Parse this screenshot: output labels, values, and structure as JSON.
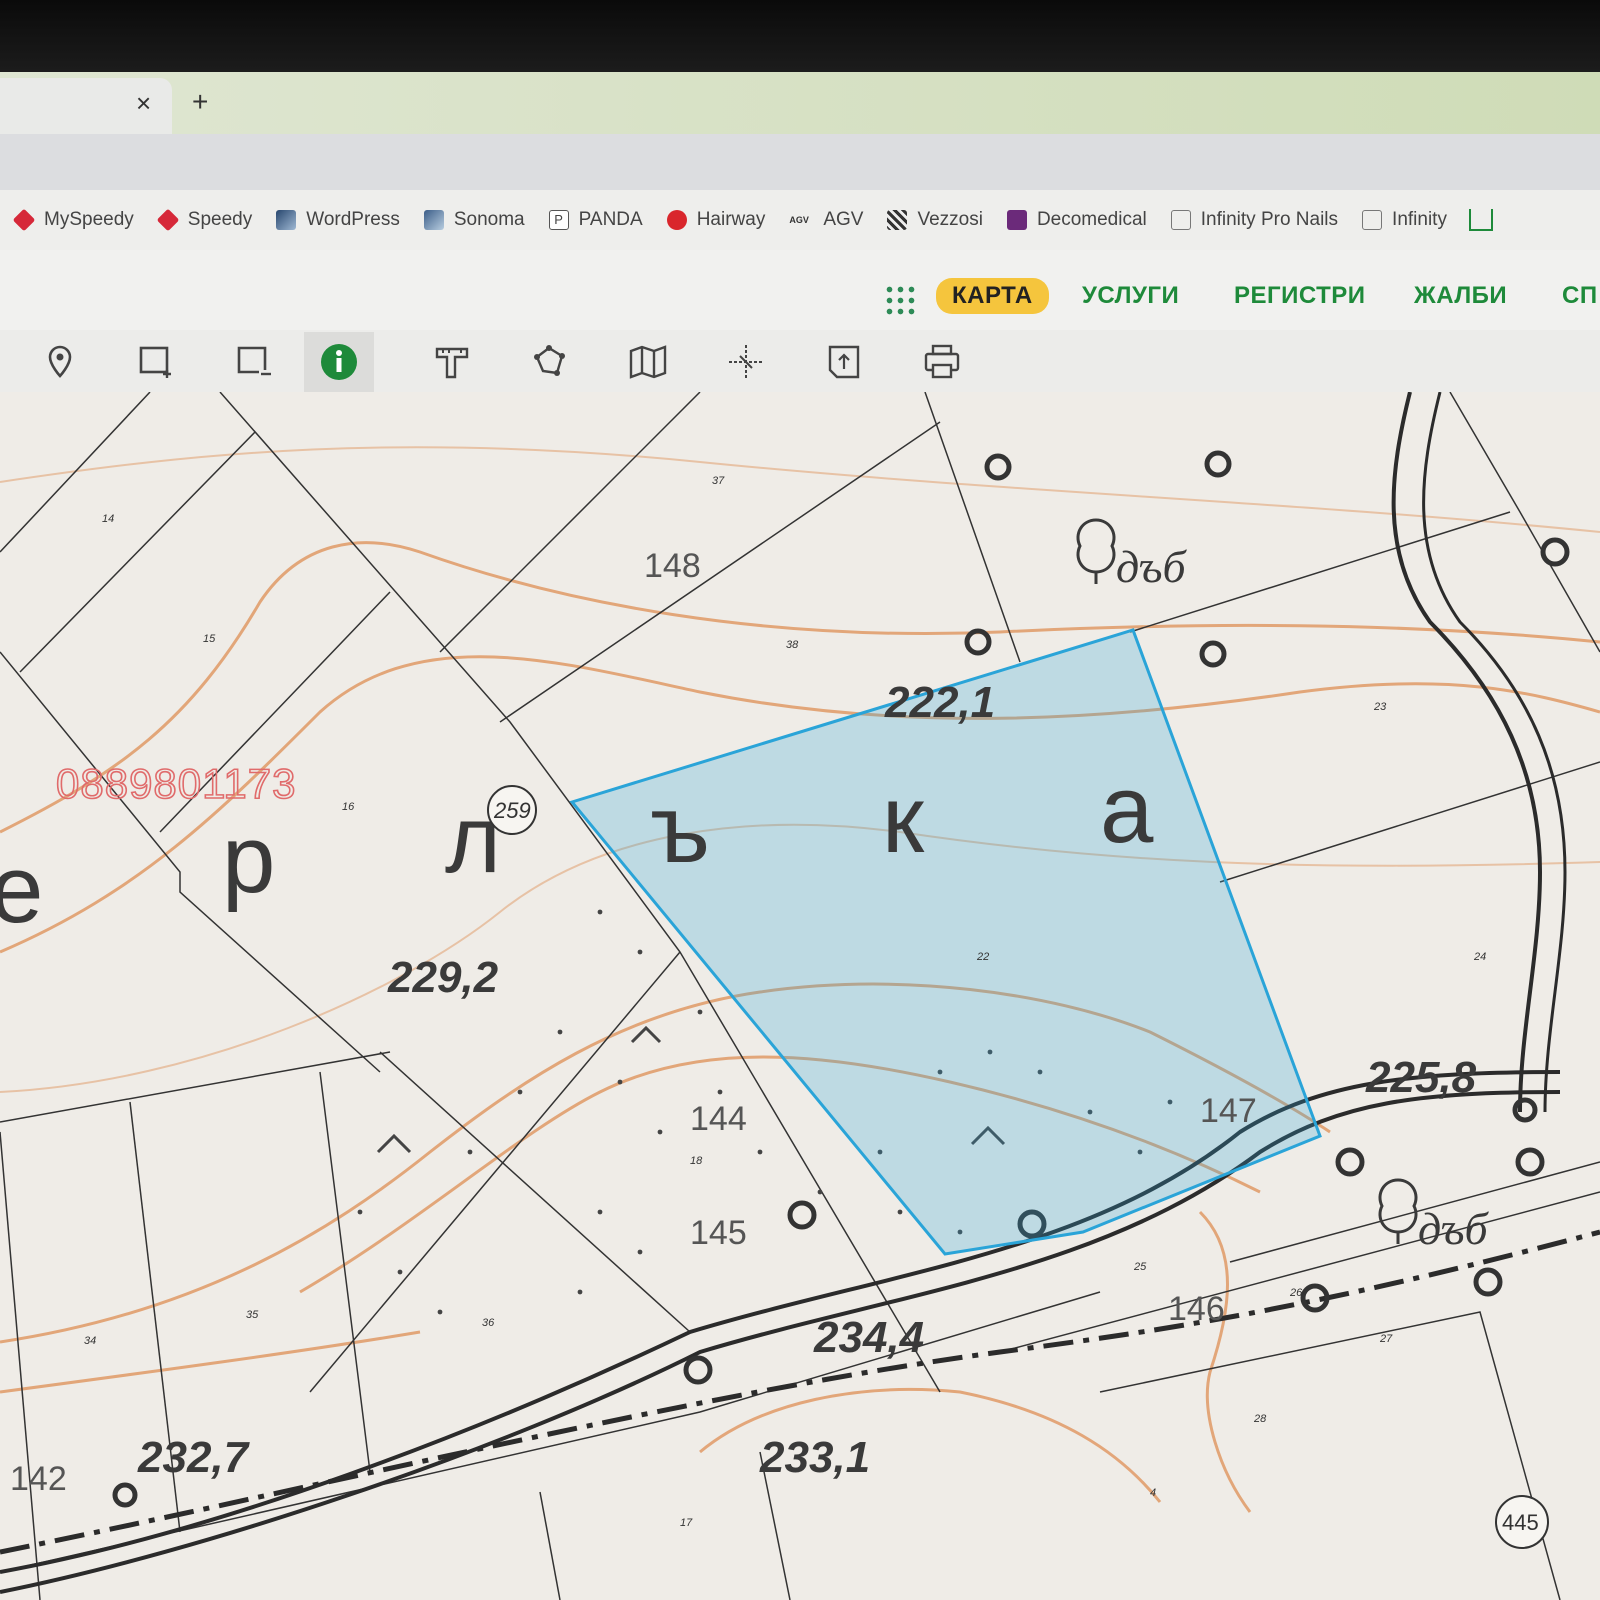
{
  "browser": {
    "tab_close": "×",
    "new_tab": "+",
    "bookmarks": [
      {
        "label": "MySpeedy",
        "icon": "speedy-cube-icon",
        "color": "#d62839"
      },
      {
        "label": "Speedy",
        "icon": "speedy-cube-icon",
        "color": "#d62839"
      },
      {
        "label": "WordPress",
        "icon": "site-thumbnail-icon",
        "color": "#4a6e9a"
      },
      {
        "label": "Sonoma",
        "icon": "site-thumbnail-icon",
        "color": "#5a7fa8"
      },
      {
        "label": "PANDA",
        "icon": "panda-p-icon",
        "color": "#555555"
      },
      {
        "label": "Hairway",
        "icon": "hairway-logo-icon",
        "color": "#d9262c"
      },
      {
        "label": "AGV",
        "icon": "agv-logo-icon",
        "color": "#333333"
      },
      {
        "label": "Vezzosi",
        "icon": "vezzosi-logo-icon",
        "color": "#333333"
      },
      {
        "label": "Decomedical",
        "icon": "decomedical-logo-icon",
        "color": "#6b2a7a"
      },
      {
        "label": "Infinity Pro Nails",
        "icon": "page-icon",
        "color": "#666666"
      },
      {
        "label": "Infinity",
        "icon": "page-icon",
        "color": "#666666"
      }
    ]
  },
  "nav": {
    "items": [
      {
        "label": "КАРТА",
        "active": true
      },
      {
        "label": "УСЛУГИ",
        "active": false
      },
      {
        "label": "РЕГИСТРИ",
        "active": false
      },
      {
        "label": "ЖАЛБИ",
        "active": false
      },
      {
        "label": "СП",
        "active": false
      }
    ],
    "accent": "#1e8a3a",
    "active_bg": "#f5c53d"
  },
  "toolbar": {
    "tools": [
      "location-pin-icon",
      "add-rectangle-icon",
      "remove-rectangle-icon",
      "info-icon",
      "measure-icon",
      "polygon-icon",
      "map-layers-icon",
      "coordinates-icon",
      "export-icon",
      "print-icon"
    ],
    "active_tool": "info-icon"
  },
  "map": {
    "watermark_phone": "0889801173",
    "highlight_color": "#2aa4d8",
    "big_letters": [
      "e",
      "р",
      "л",
      "ъ",
      "к",
      "а"
    ],
    "elevations": [
      "222,1",
      "229,2",
      "225,8",
      "234,4",
      "232,7",
      "233,1"
    ],
    "parcel_numbers": [
      "148",
      "144",
      "145",
      "147",
      "146",
      "142"
    ],
    "circled_labels": [
      "259",
      "445"
    ],
    "vegetation_labels": [
      "дъб",
      "дъб"
    ],
    "small_parcel_ids": [
      "37",
      "14",
      "15",
      "38",
      "16",
      "23",
      "22",
      "24",
      "18",
      "35",
      "34",
      "36",
      "25",
      "26",
      "27",
      "28",
      "17",
      "4"
    ]
  }
}
